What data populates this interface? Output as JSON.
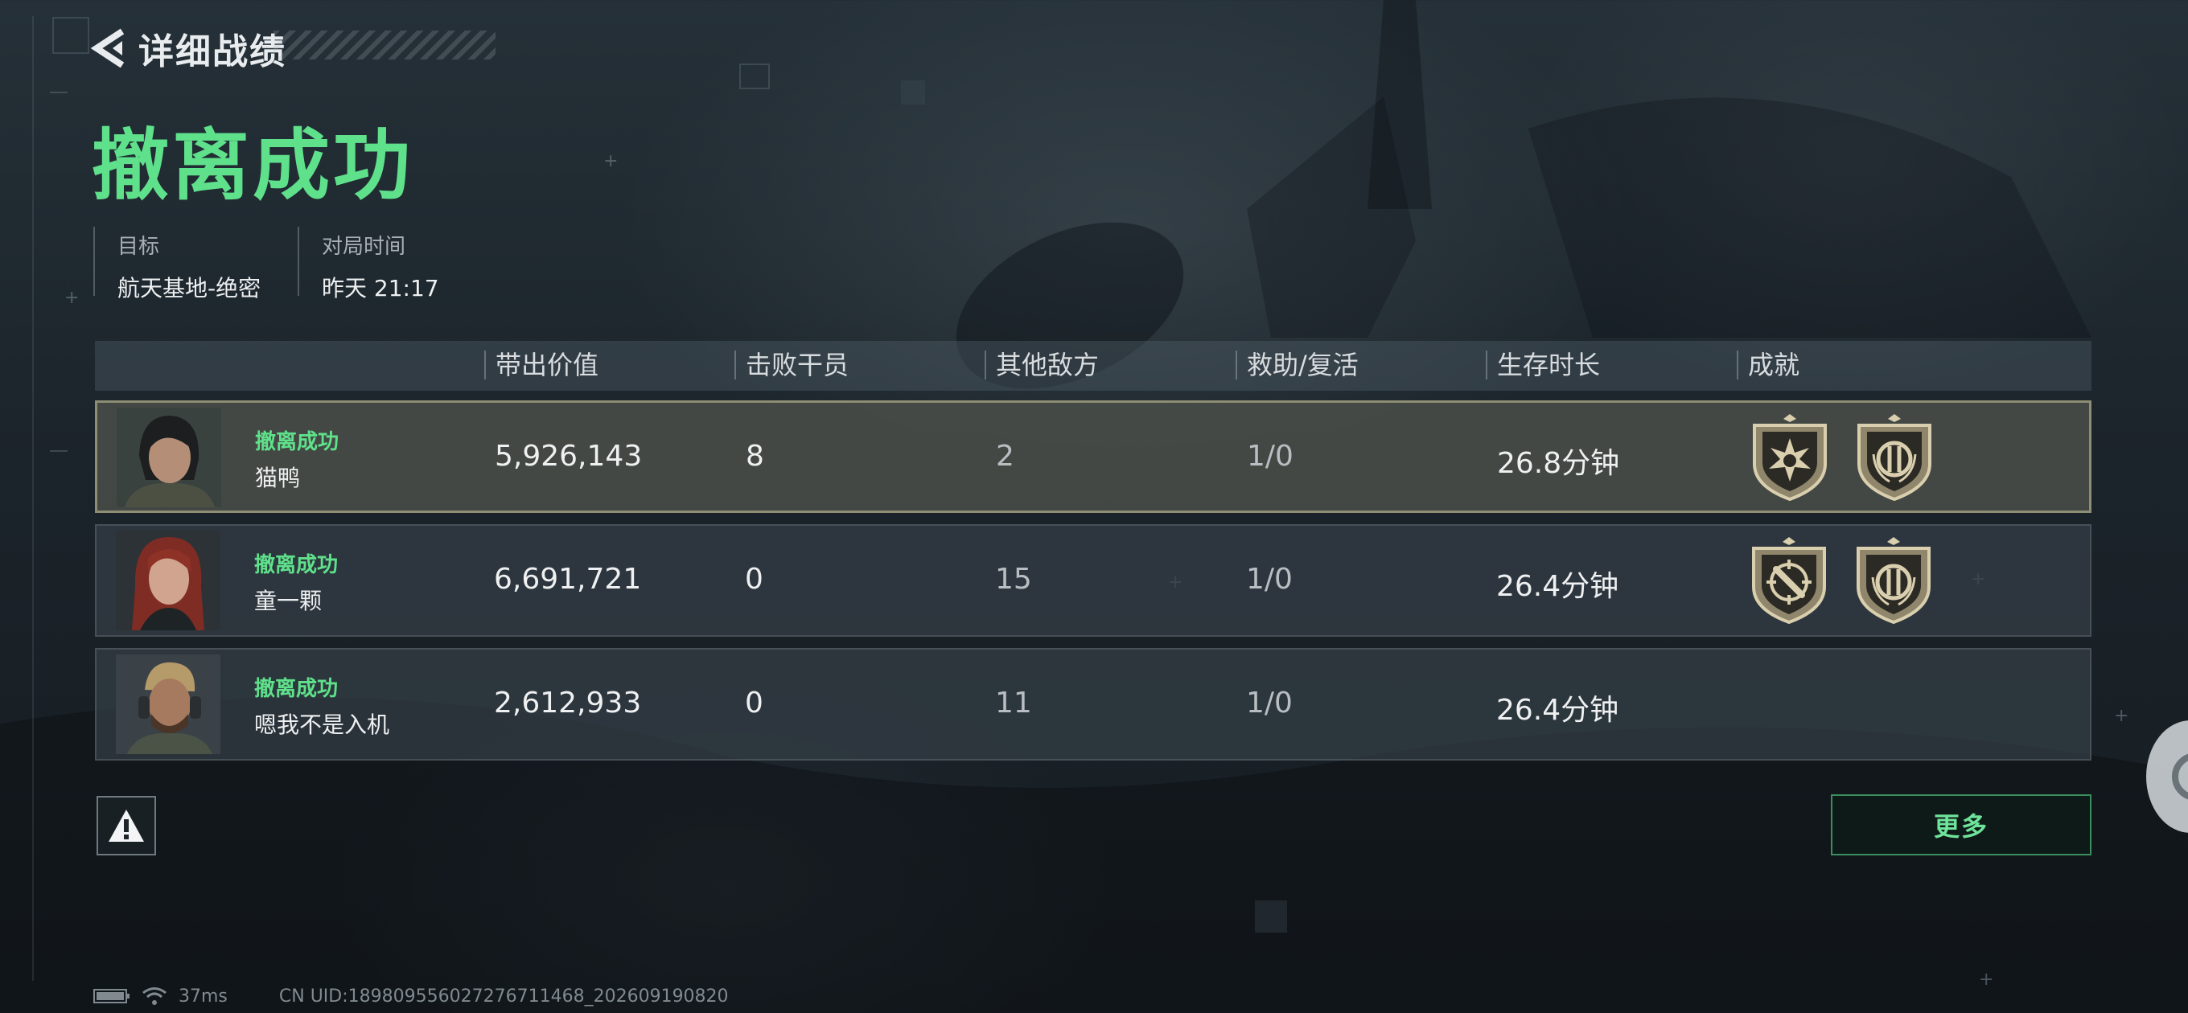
{
  "header": {
    "back_title": "详细战绩",
    "main_title": "撤离成功"
  },
  "info": {
    "target_label": "目标",
    "target_value": "航天基地-绝密",
    "time_label": "对局时间",
    "time_value": "昨天 21:17"
  },
  "table": {
    "columns": [
      "带出价值",
      "击败干员",
      "其他敌方",
      "救助/复活",
      "生存时长",
      "成就"
    ],
    "rows": [
      {
        "status": "撤离成功",
        "name": "猫鸭",
        "value": "5,926,143",
        "kills": "8",
        "other": "2",
        "assist": "1/0",
        "survival": "26.8分钟",
        "badges": [
          "sunburst-badge-icon",
          "laurel-badge-icon"
        ]
      },
      {
        "status": "撤离成功",
        "name": "童一颗",
        "value": "6,691,721",
        "kills": "0",
        "other": "15",
        "assist": "1/0",
        "survival": "26.4分钟",
        "badges": [
          "crosshair-badge-icon",
          "laurel-badge-icon"
        ]
      },
      {
        "status": "撤离成功",
        "name": "嗯我不是入机",
        "value": "2,612,933",
        "kills": "0",
        "other": "11",
        "assist": "1/0",
        "survival": "26.4分钟",
        "badges": []
      }
    ]
  },
  "actions": {
    "more_label": "更多",
    "report_icon": "warning-icon"
  },
  "footer": {
    "ping": "37ms",
    "uid": "CN UID:18980955602727671146​8_202609190820"
  },
  "colors": {
    "accent_green": "#5fe08b",
    "badge_gold": "#b9ab86",
    "highlight_border": "#8e8e74"
  }
}
